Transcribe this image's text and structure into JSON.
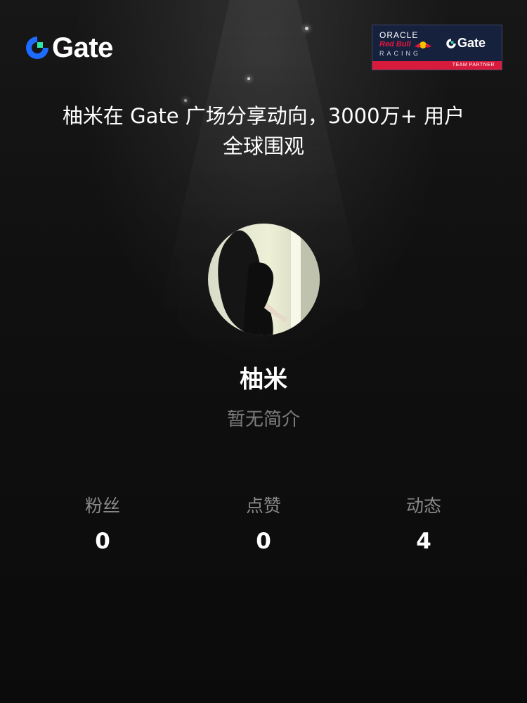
{
  "brand": {
    "logo_text": "Gate",
    "logo_icon": "gate-logo-icon",
    "accent": "#1e6bff",
    "accent_green": "#2fe5a7"
  },
  "partner_badge": {
    "oracle": "ORACLE",
    "red_bull": "Red Bull",
    "racing": "RACING",
    "gate": "Gate",
    "team_partner": "TEAM PARTNER",
    "bg_color": "#16213e",
    "strip_color": "#d81b3c"
  },
  "headline": {
    "line1": "柚米在 Gate 广场分享动向，3000万+ 用户",
    "line2": "全球围观"
  },
  "profile": {
    "avatar_icon": "profile-avatar",
    "name": "柚米",
    "bio": "暂无简介"
  },
  "stats": [
    {
      "label": "粉丝",
      "value": "0"
    },
    {
      "label": "点赞",
      "value": "0"
    },
    {
      "label": "动态",
      "value": "4"
    }
  ]
}
